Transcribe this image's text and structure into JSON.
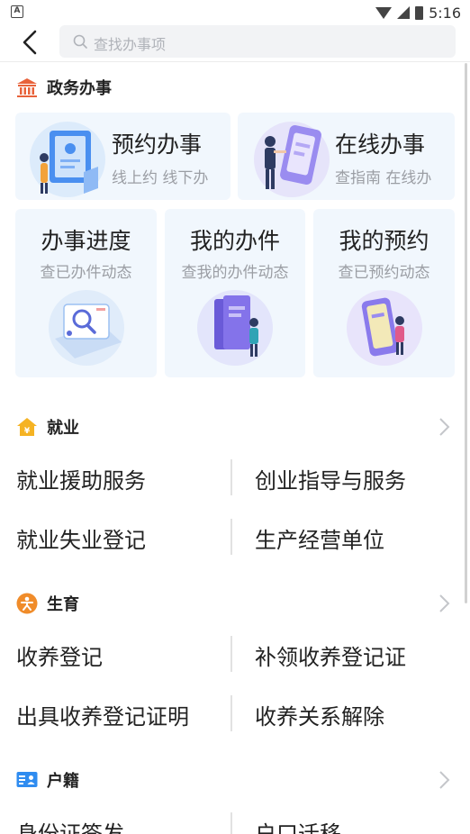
{
  "status_bar": {
    "time": "5:16",
    "notification_icon": "A"
  },
  "search": {
    "placeholder": "查找办事项"
  },
  "sections": {
    "gov": {
      "title": "政务办事",
      "icon": "government-building-icon",
      "color": "#e8623a"
    },
    "employment": {
      "title": "就业",
      "icon": "employment-house-icon",
      "color": "#f5b323"
    },
    "birth": {
      "title": "生育",
      "icon": "birth-person-icon",
      "color": "#f08c2a"
    },
    "household": {
      "title": "户籍",
      "icon": "household-id-card-icon",
      "color": "#2f8cf0"
    }
  },
  "gov_cards": {
    "appointment": {
      "title": "预约办事",
      "subtitle": "线上约 线下办"
    },
    "online": {
      "title": "在线办事",
      "subtitle": "查指南 在线办"
    },
    "progress": {
      "title": "办事进度",
      "subtitle": "查已办件动态"
    },
    "my_cases": {
      "title": "我的办件",
      "subtitle": "查我的办件动态"
    },
    "my_appointments": {
      "title": "我的预约",
      "subtitle": "查已预约动态"
    }
  },
  "employment_items": [
    "就业援助服务",
    "创业指导与服务",
    "就业失业登记",
    "生产经营单位"
  ],
  "birth_items": [
    "收养登记",
    "补领收养登记证",
    "出具收养登记证明",
    "收养关系解除"
  ],
  "household_items": [
    "身份证签发",
    "户口迁移"
  ]
}
